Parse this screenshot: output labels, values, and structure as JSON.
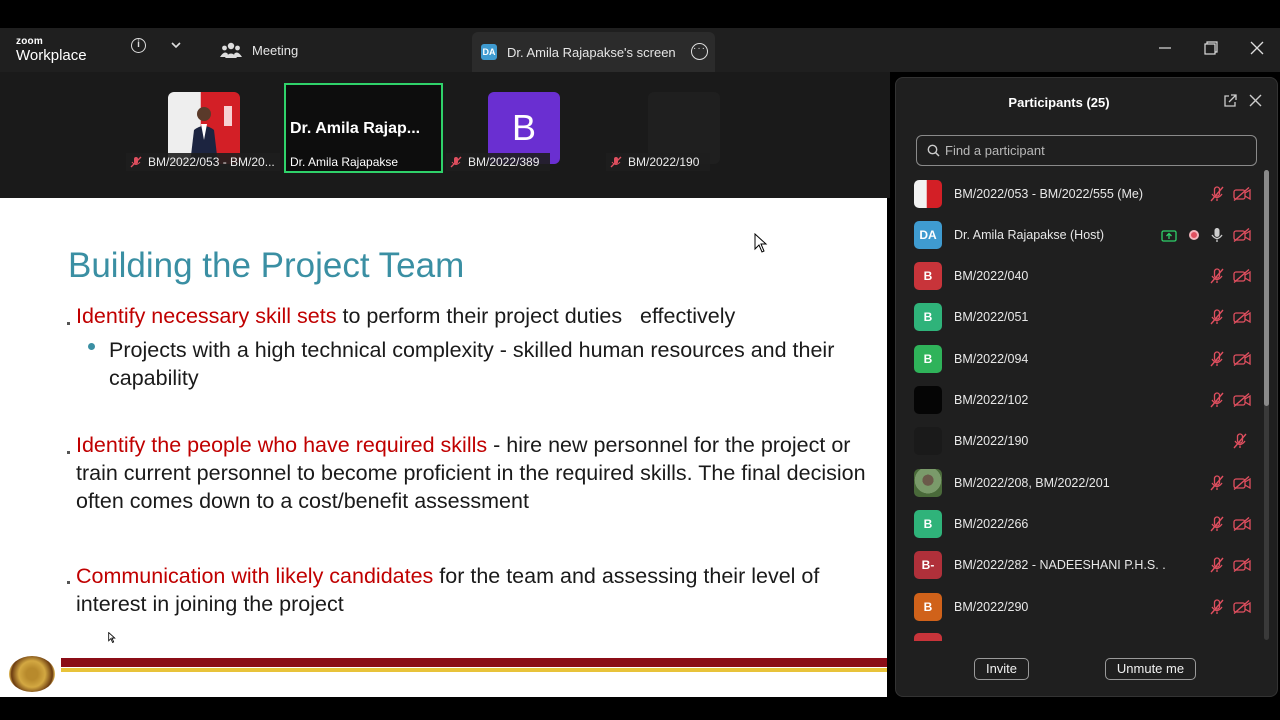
{
  "app": {
    "brand_small": "zoom",
    "brand_large": "Workplace"
  },
  "tabs": {
    "meeting": "Meeting",
    "screen_badge": "DA",
    "screen": "Dr. Amila Rajapakse's screen"
  },
  "strip": {
    "tiles": [
      {
        "name": "BM/2022/053 - BM/2022/555 (Me)",
        "display": "BM/2022/053 - BM/20...",
        "muted": true
      },
      {
        "name": "Dr. Amila Rajapakse",
        "big_label": "Dr. Amila Rajap...",
        "muted": false
      },
      {
        "name": "BM/2022/389",
        "initial": "B",
        "muted": true,
        "color": "#6a2fd1"
      },
      {
        "name": "BM/2022/190",
        "muted": true
      }
    ]
  },
  "slide": {
    "title": "Building the Project Team",
    "p1_red": "Identify necessary skill sets",
    "p1_rest": " to perform their project duties   effectively",
    "sub1": "Projects with a high technical complexity - skilled human resources and their capability",
    "p2_red": "Identify the people who have required skills",
    "p2_rest": " - hire new personnel for the project or train current personnel to become proficient in the required skills. The final decision often comes down to a cost/benefit assessment",
    "p3_red": "Communication with likely candidates",
    "p3_rest": " for the team and assessing their level of interest in joining the project",
    "colors": {
      "title": "#3a8fa3",
      "emphasis": "#c00000",
      "band_red": "#8b0d17",
      "band_gold": "#e8c33a"
    }
  },
  "participants": {
    "title": "Participants (25)",
    "search_placeholder": "Find a participant",
    "list": [
      {
        "name": "BM/2022/053 - BM/2022/555 (Me)",
        "avatar": "",
        "avatar_color": "photo",
        "mic": "off",
        "cam": "off"
      },
      {
        "name": "Dr. Amila Rajapakse (Host)",
        "avatar": "DA",
        "avatar_color": "#3f9bd0",
        "mic": "on",
        "cam": "off",
        "sharing": true,
        "recording": true
      },
      {
        "name": "BM/2022/040",
        "avatar": "B",
        "avatar_color": "#c8343a",
        "mic": "off",
        "cam": "off"
      },
      {
        "name": "BM/2022/051",
        "avatar": "B",
        "avatar_color": "#2fb37a",
        "mic": "off",
        "cam": "off"
      },
      {
        "name": "BM/2022/094",
        "avatar": "B",
        "avatar_color": "#2fb35a",
        "mic": "off",
        "cam": "off"
      },
      {
        "name": "BM/2022/102",
        "avatar": "",
        "avatar_color": "#050505",
        "mic": "off",
        "cam": "off"
      },
      {
        "name": "BM/2022/190",
        "avatar": "",
        "avatar_color": "#1a1a1a",
        "mic": "off",
        "cam": "none"
      },
      {
        "name": "BM/2022/208, BM/2022/201",
        "avatar": "",
        "avatar_color": "photo2",
        "mic": "off",
        "cam": "off"
      },
      {
        "name": "BM/2022/266",
        "avatar": "B",
        "avatar_color": "#2fb37a",
        "mic": "off",
        "cam": "off"
      },
      {
        "name": "BM/2022/282 - NADEESHANI P.H.S. .",
        "avatar": "B-",
        "avatar_color": "#b0303a",
        "mic": "off",
        "cam": "off"
      },
      {
        "name": "BM/2022/290",
        "avatar": "B",
        "avatar_color": "#d0621a",
        "mic": "off",
        "cam": "off"
      }
    ],
    "invite_label": "Invite",
    "unmute_label": "Unmute me"
  }
}
